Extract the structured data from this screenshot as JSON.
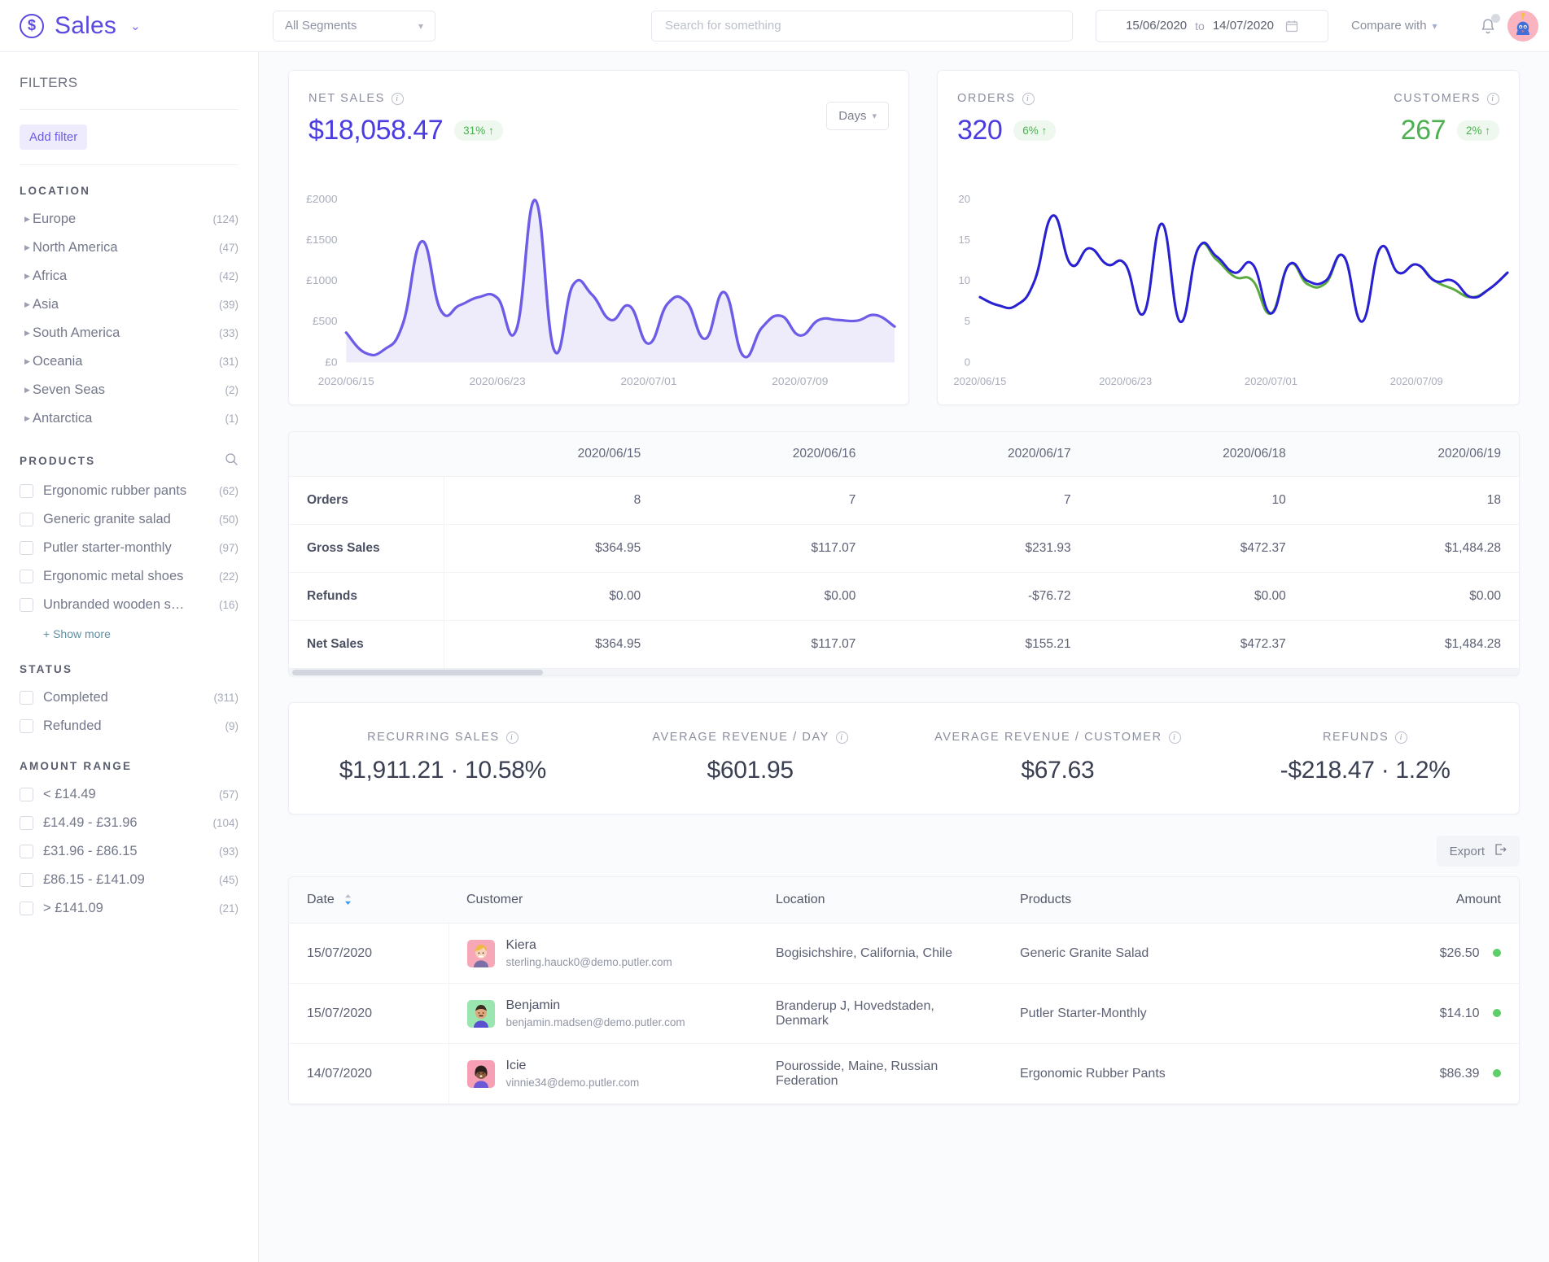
{
  "header": {
    "brand_icon": "dollar-circle-icon",
    "brand_title": "Sales",
    "brand_caret": "⌄",
    "segment_value": "All Segments",
    "search_placeholder": "Search for something",
    "date_from": "15/06/2020",
    "date_to_label": "to",
    "date_to": "14/07/2020",
    "compare_label": "Compare with",
    "notifications_icon": "bell-icon",
    "avatar_icon": "avatar"
  },
  "sidebar": {
    "title": "FILTERS",
    "add_filter_label": "Add filter",
    "sections": [
      {
        "name": "LOCATION",
        "type": "tree",
        "items": [
          {
            "label": "Europe",
            "count": "(124)"
          },
          {
            "label": "North America",
            "count": "(47)"
          },
          {
            "label": "Africa",
            "count": "(42)"
          },
          {
            "label": "Asia",
            "count": "(39)"
          },
          {
            "label": "South America",
            "count": "(33)"
          },
          {
            "label": "Oceania",
            "count": "(31)"
          },
          {
            "label": "Seven Seas",
            "count": "(2)"
          },
          {
            "label": "Antarctica",
            "count": "(1)"
          }
        ]
      },
      {
        "name": "PRODUCTS",
        "type": "checkbox",
        "has_search": true,
        "items": [
          {
            "label": "Ergonomic rubber pants",
            "count": "(62)"
          },
          {
            "label": "Generic granite salad",
            "count": "(50)"
          },
          {
            "label": "Putler starter-monthly",
            "count": "(97)"
          },
          {
            "label": "Ergonomic metal shoes",
            "count": "(22)"
          },
          {
            "label": "Unbranded wooden s…",
            "count": "(16)"
          }
        ],
        "show_more": "+ Show more"
      },
      {
        "name": "STATUS",
        "type": "checkbox",
        "items": [
          {
            "label": "Completed",
            "count": "(311)"
          },
          {
            "label": "Refunded",
            "count": "(9)"
          }
        ]
      },
      {
        "name": "AMOUNT RANGE",
        "type": "checkbox",
        "items": [
          {
            "label": "< £14.49",
            "count": "(57)"
          },
          {
            "label": "£14.49 - £31.96",
            "count": "(104)"
          },
          {
            "label": "£31.96 - £86.15",
            "count": "(93)"
          },
          {
            "label": "£86.15 - £141.09",
            "count": "(45)"
          },
          {
            "label": "> £141.09",
            "count": "(21)"
          }
        ]
      }
    ]
  },
  "net_sales_card": {
    "label": "NET SALES",
    "value": "$18,058.47",
    "delta": "31% ↑",
    "granularity": "Days"
  },
  "orders_card": {
    "orders_label": "ORDERS",
    "orders_value": "320",
    "orders_delta": "6% ↑",
    "customers_label": "CUSTOMERS",
    "customers_value": "267",
    "customers_delta": "2% ↑"
  },
  "chart_data": [
    {
      "type": "area",
      "title": "NET SALES",
      "ylabel": "",
      "xlabel": "",
      "ylim": [
        0,
        2100
      ],
      "yticks": [
        "£0",
        "£500",
        "£1000",
        "£1500",
        "£2000"
      ],
      "ytick_values": [
        0,
        500,
        1000,
        1500,
        2000
      ],
      "xticks": [
        "2020/06/15",
        "2020/06/23",
        "2020/07/01",
        "2020/07/09"
      ],
      "xtick_index": [
        0,
        8,
        16,
        24
      ],
      "grid": false,
      "legend": "none",
      "line_color": "#6c5ce7",
      "fill_color": "#eeebfb",
      "x": [
        "2020/06/15",
        "2020/06/16",
        "2020/06/17",
        "2020/06/18",
        "2020/06/19",
        "2020/06/20",
        "2020/06/21",
        "2020/06/22",
        "2020/06/23",
        "2020/06/24",
        "2020/06/25",
        "2020/06/26",
        "2020/06/27",
        "2020/06/28",
        "2020/06/29",
        "2020/06/30",
        "2020/07/01",
        "2020/07/02",
        "2020/07/03",
        "2020/07/04",
        "2020/07/05",
        "2020/07/06",
        "2020/07/07",
        "2020/07/08",
        "2020/07/09",
        "2020/07/10",
        "2020/07/11",
        "2020/07/12",
        "2020/07/13",
        "2020/07/14"
      ],
      "values": [
        365,
        117,
        155,
        472,
        1484,
        640,
        700,
        800,
        790,
        400,
        1990,
        150,
        950,
        830,
        520,
        690,
        230,
        720,
        740,
        290,
        860,
        80,
        430,
        570,
        330,
        520,
        520,
        510,
        580,
        440
      ]
    },
    {
      "type": "line",
      "title": "ORDERS",
      "ylabel": "",
      "xlabel": "",
      "ylim": [
        0,
        21
      ],
      "yticks": [
        "0",
        "5",
        "10",
        "15",
        "20"
      ],
      "ytick_values": [
        0,
        5,
        10,
        15,
        20
      ],
      "xticks": [
        "2020/06/15",
        "2020/06/23",
        "2020/07/01",
        "2020/07/09"
      ],
      "grid": false,
      "legend": "none",
      "series": [
        {
          "name": "Orders",
          "color": "#2a1fd6",
          "values": [
            8,
            7,
            7,
            10,
            18,
            12,
            14,
            12,
            12,
            6,
            17,
            5,
            14,
            13,
            11,
            12,
            6,
            12,
            10,
            10,
            13,
            5,
            14,
            11,
            12,
            10,
            10,
            8,
            9,
            11
          ]
        },
        {
          "name": "Customers",
          "color": "#5aab3f",
          "values": [
            8,
            7,
            7,
            10,
            18,
            12,
            14,
            12,
            12,
            6,
            17,
            5,
            14,
            12.6,
            10.5,
            10,
            6,
            12,
            9.6,
            9.7,
            13,
            5,
            14,
            11,
            12,
            10,
            9,
            8,
            9,
            11
          ]
        }
      ]
    }
  ],
  "metrics_table": {
    "columns": [
      "",
      "2020/06/15",
      "2020/06/16",
      "2020/06/17",
      "2020/06/18",
      "2020/06/19"
    ],
    "rows": [
      {
        "label": "Orders",
        "values": [
          "8",
          "7",
          "7",
          "10",
          "18"
        ]
      },
      {
        "label": "Gross Sales",
        "values": [
          "$364.95",
          "$117.07",
          "$231.93",
          "$472.37",
          "$1,484.28"
        ]
      },
      {
        "label": "Refunds",
        "values": [
          "$0.00",
          "$0.00",
          "-$76.72",
          "$0.00",
          "$0.00"
        ]
      },
      {
        "label": "Net Sales",
        "values": [
          "$364.95",
          "$117.07",
          "$155.21",
          "$472.37",
          "$1,484.28"
        ]
      }
    ]
  },
  "summary": [
    {
      "label": "RECURRING SALES",
      "value": "$1,911.21 · 10.58%"
    },
    {
      "label": "AVERAGE REVENUE / DAY",
      "value": "$601.95"
    },
    {
      "label": "AVERAGE REVENUE / CUSTOMER",
      "value": "$67.63"
    },
    {
      "label": "REFUNDS",
      "value": "-$218.47 · 1.2%"
    }
  ],
  "export": {
    "label": "Export",
    "icon": "export-icon"
  },
  "transactions": {
    "columns": [
      "Date",
      "Customer",
      "Location",
      "Products",
      "Amount"
    ],
    "rows": [
      {
        "date": "15/07/2020",
        "name": "Kiera",
        "email": "sterling.hauck0@demo.putler.com",
        "avatar_bg": "#f7a8b8",
        "location": "Bogisichshire, California, Chile",
        "product": "Generic Granite Salad",
        "amount": "$26.50",
        "status_color": "#5ece68"
      },
      {
        "date": "15/07/2020",
        "name": "Benjamin",
        "email": "benjamin.madsen@demo.putler.com",
        "avatar_bg": "#9ae5b0",
        "location": "Branderup J, Hovedstaden, Denmark",
        "product": "Putler Starter-Monthly",
        "amount": "$14.10",
        "status_color": "#5ece68"
      },
      {
        "date": "14/07/2020",
        "name": "Icie",
        "email": "vinnie34@demo.putler.com",
        "avatar_bg": "#f79fb4",
        "location": "Pourosside, Maine, Russian Federation",
        "product": "Ergonomic Rubber Pants",
        "amount": "$86.39",
        "status_color": "#5ece68"
      }
    ]
  },
  "colors": {
    "brand": "#5b4ae0",
    "accent_green": "#49b24e",
    "chart_purple": "#6c5ce7",
    "chart_blue": "#2a1fd6",
    "chart_green": "#5aab3f"
  }
}
